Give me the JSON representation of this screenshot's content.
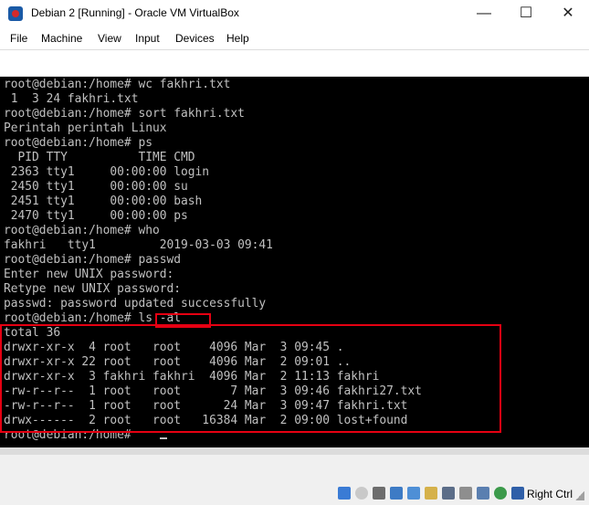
{
  "window": {
    "title": "Debian 2 [Running] - Oracle VM VirtualBox",
    "minimize_glyph": "—",
    "maximize_glyph": "☐",
    "close_glyph": "✕"
  },
  "menu": [
    "File",
    "Machine",
    "View",
    "Input",
    "Devices",
    "Help"
  ],
  "terminal": {
    "lines": [
      "root@debian:/home# wc fakhri.txt",
      " 1  3 24 fakhri.txt",
      "root@debian:/home# sort fakhri.txt",
      "Perintah perintah Linux",
      "root@debian:/home# ps",
      "  PID TTY          TIME CMD",
      " 2363 tty1     00:00:00 login",
      " 2450 tty1     00:00:00 su",
      " 2451 tty1     00:00:00 bash",
      " 2470 tty1     00:00:00 ps",
      "root@debian:/home# who",
      "fakhri   tty1         2019-03-03 09:41",
      "root@debian:/home# passwd",
      "Enter new UNIX password:",
      "Retype new UNIX password:",
      "passwd: password updated successfully",
      "root@debian:/home# ls -al",
      "total 36",
      "drwxr-xr-x  4 root   root    4096 Mar  3 09:45 .",
      "drwxr-xr-x 22 root   root    4096 Mar  2 09:01 ..",
      "drwxr-xr-x  3 fakhri fakhri  4096 Mar  2 11:13 fakhri",
      "-rw-r--r--  1 root   root       7 Mar  3 09:46 fakhri27.txt",
      "-rw-r--r--  1 root   root      24 Mar  3 09:47 fakhri.txt",
      "drwx------  2 root   root   16384 Mar  2 09:00 lost+found",
      "root@debian:/home# "
    ]
  },
  "statusbar": {
    "host_key": "Right Ctrl",
    "icons": [
      "hard-disk-icon",
      "optical-drive-icon",
      "audio-icon",
      "network-icon",
      "usb-icon",
      "shared-folders-icon",
      "display-icon",
      "recording-icon",
      "cpu-icon",
      "guest-additions-icon",
      "mouse-integration-icon",
      "keyboard-icon"
    ]
  },
  "colors": {
    "terminal_bg": "#000000",
    "terminal_fg": "#c0c0c0",
    "highlight": "#e60012"
  }
}
